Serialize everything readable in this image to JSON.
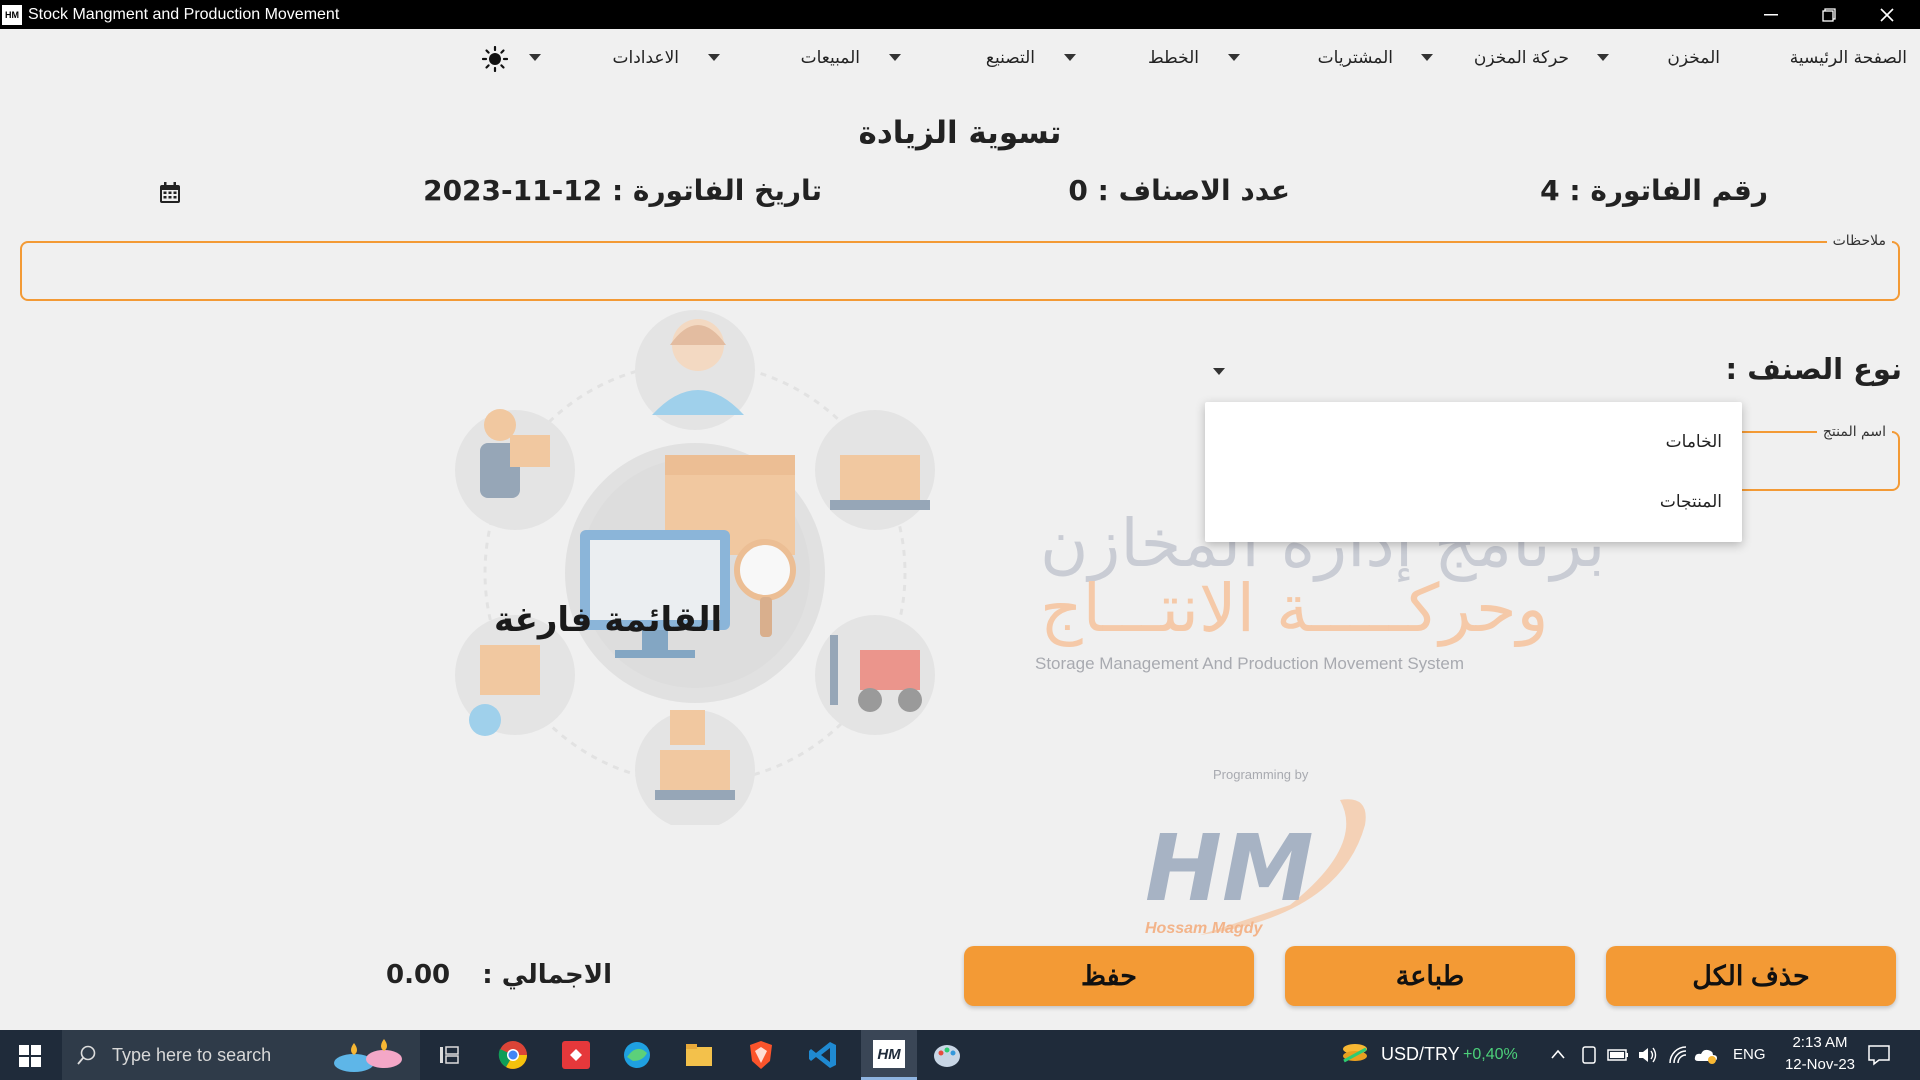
{
  "window": {
    "title": "Stock Mangment and Production Movement",
    "icon_text": "HM"
  },
  "menu": {
    "home": "الصفحة الرئيسية",
    "warehouse": "المخزن",
    "stock_movement": "حركة المخزن",
    "purchases": "المشتريات",
    "plans": "الخطط",
    "manufacturing": "التصنيع",
    "sales": "المبيعات",
    "settings": "الاعدادات"
  },
  "page": {
    "title": "تسوية الزيادة",
    "invoice_number": "رقم الفاتورة : 4",
    "item_count": "عدد الاصناف : 0",
    "invoice_date": "تاريخ الفاتورة : 12-11-2023"
  },
  "form": {
    "notes_label": "ملاحظات",
    "item_type_label": "نوع الصنف :",
    "product_name_label": "اسم المنتج",
    "dropdown_options": [
      "الخامات",
      "المنتجات"
    ]
  },
  "watermark": {
    "line1": "برنامج إدارة المخازن",
    "line2": "وحركـــــة الانتـــاج",
    "english": "Storage Management And Production Movement System",
    "programming_by": "Programming by",
    "logo": "HM",
    "author": "Hossam Magdy"
  },
  "list": {
    "empty_message": "القائمة فارغة"
  },
  "buttons": {
    "delete_all": "حذف الكل",
    "print": "طباعة",
    "save": "حفظ"
  },
  "totals": {
    "label": "الاجمالي :",
    "value": "0.00"
  },
  "taskbar": {
    "search_placeholder": "Type here to search",
    "ticker": "USD/TRY",
    "ticker_change": "+0,40%",
    "language": "ENG",
    "time": "2:13 AM",
    "date": "12-Nov-23"
  },
  "colors": {
    "accent": "#f39a35",
    "background": "#f0f0f0",
    "taskbar": "#1f2b3a"
  }
}
